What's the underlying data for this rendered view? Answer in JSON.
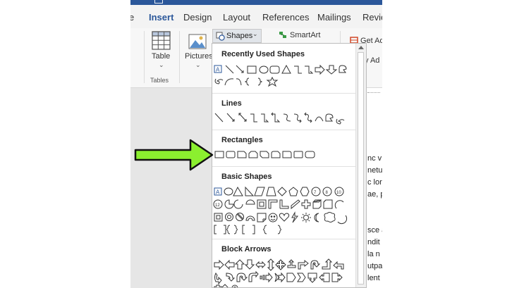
{
  "ribbon_tabs": {
    "prefix": "e",
    "insert": "Insert",
    "design": "Design",
    "layout": "Layout",
    "references": "References",
    "mailings": "Mailings",
    "review": "Revie"
  },
  "ribbon": {
    "table_label": "Table",
    "pictures_label": "Pictures",
    "tables_group": "Tables",
    "shapes_label": "Shapes",
    "smartart_label": "SmartArt",
    "getaddins_label": "Get Ad",
    "myaddins_label": "y Ad"
  },
  "shapes_menu": {
    "sections": {
      "recent": "Recently Used Shapes",
      "lines": "Lines",
      "rectangles": "Rectangles",
      "basic": "Basic Shapes",
      "block_arrows": "Block Arrows"
    }
  },
  "document_fragments": [
    "nc v",
    "netu",
    "c lor",
    "ae, p",
    "sce a",
    "ndit",
    "la n",
    "utpa",
    "lent"
  ],
  "colors": {
    "accent": "#2b579a",
    "arrow_fill": "#8bef2f",
    "arrow_stroke": "#111111"
  },
  "icons": [
    "table-icon",
    "pictures-icon",
    "shapes-icon",
    "smartart-icon",
    "store-icon",
    "scroll-up-icon",
    "green-arrow-pointer"
  ]
}
